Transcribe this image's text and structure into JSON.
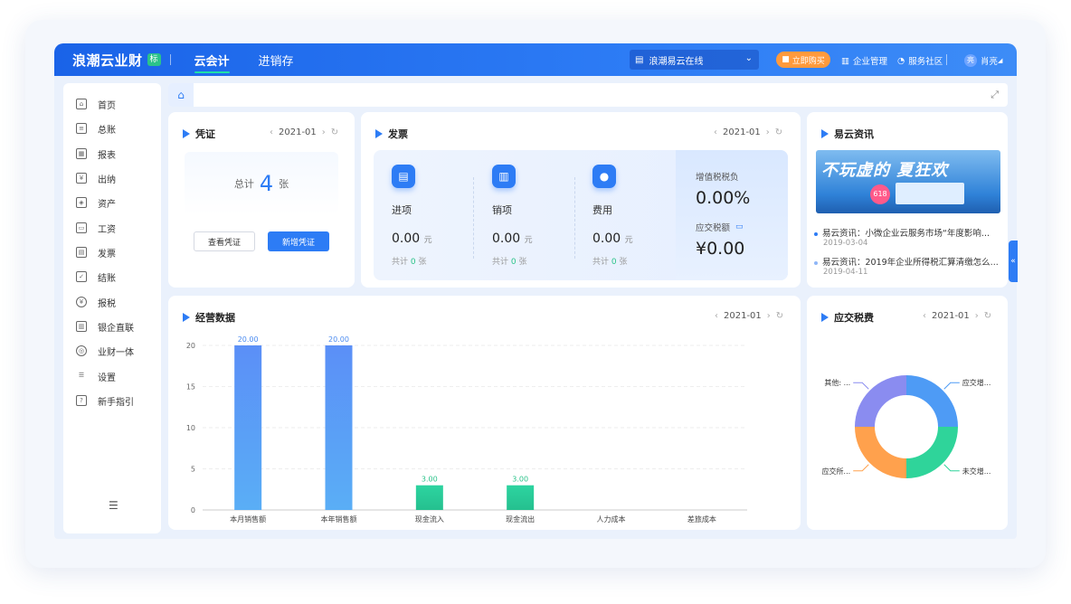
{
  "header": {
    "brand": "浪潮云业财",
    "brand_badge": "标",
    "tabs": [
      {
        "label": "云会计"
      },
      {
        "label": "进销存"
      }
    ],
    "org_select": "浪潮易云在线",
    "buy_button": "立即购买",
    "enterprise": "企业管理",
    "community": "服务社区",
    "user_avatar": "亮",
    "user": "肖亮"
  },
  "sidebar": {
    "items": [
      {
        "label": "首页"
      },
      {
        "label": "总账"
      },
      {
        "label": "报表"
      },
      {
        "label": "出纳"
      },
      {
        "label": "资产"
      },
      {
        "label": "工资"
      },
      {
        "label": "发票"
      },
      {
        "label": "结账"
      },
      {
        "label": "报税"
      },
      {
        "label": "银企直联"
      },
      {
        "label": "业财一体"
      },
      {
        "label": "设置"
      },
      {
        "label": "新手指引"
      }
    ]
  },
  "voucher": {
    "title": "凭证",
    "period": "2021-01",
    "total_prefix": "总计",
    "total": "4",
    "unit": "张",
    "view_button": "查看凭证",
    "add_button": "新增凭证"
  },
  "invoice": {
    "title": "发票",
    "period": "2021-01",
    "columns": [
      {
        "label": "进项",
        "amount": "0.00",
        "currency": "元",
        "count_prefix": "共计",
        "count": "0",
        "count_unit": "张"
      },
      {
        "label": "销项",
        "amount": "0.00",
        "currency": "元",
        "count_prefix": "共计",
        "count": "0",
        "count_unit": "张"
      },
      {
        "label": "费用",
        "amount": "0.00",
        "currency": "元",
        "count_prefix": "共计",
        "count": "0",
        "count_unit": "张"
      }
    ],
    "vat_label": "增值税税负",
    "vat_value": "0.00%",
    "tax_due_label": "应交税额",
    "tax_due_value": "¥0.00"
  },
  "news": {
    "title": "易云资讯",
    "banner_text": "不玩虚的 夏狂欢",
    "banner_tag": "618",
    "items": [
      {
        "text": "易云资讯：小微企业云服务市场“年度影响...",
        "date": "2019-03-04"
      },
      {
        "text": "易云资讯：2019年企业所得税汇算清缴怎么...",
        "date": "2019-04-11"
      }
    ]
  },
  "business": {
    "title": "经营数据",
    "period": "2021-01"
  },
  "tax": {
    "title": "应交税费",
    "period": "2021-01",
    "labels": [
      "其他: ...",
      "应交增...",
      "未交增...",
      "应交所..."
    ]
  },
  "colors": {
    "primary": "#2d7cf5",
    "green": "#2bc38a",
    "orange": "#ff9a3c"
  },
  "chart_data": [
    {
      "type": "bar",
      "title": "",
      "categories": [
        "本月销售额",
        "本年销售额",
        "现金流入",
        "现金流出",
        "人力成本",
        "差旅成本"
      ],
      "values": [
        20.0,
        20.0,
        3.0,
        3.0,
        0,
        0
      ],
      "value_labels": [
        "20.00",
        "20.00",
        "3.00",
        "3.00",
        "",
        ""
      ],
      "ylim": [
        0,
        20
      ],
      "yticks": [
        0,
        5,
        10,
        15,
        20
      ],
      "grid": true
    },
    {
      "type": "pie",
      "title": "",
      "labels": [
        "应交增...",
        "未交增...",
        "应交所...",
        "其他: ..."
      ],
      "values": [
        25,
        25,
        25,
        25
      ],
      "colors": [
        "#4e9bf5",
        "#2fd49a",
        "#ffa14d",
        "#8a8cf0"
      ]
    }
  ]
}
